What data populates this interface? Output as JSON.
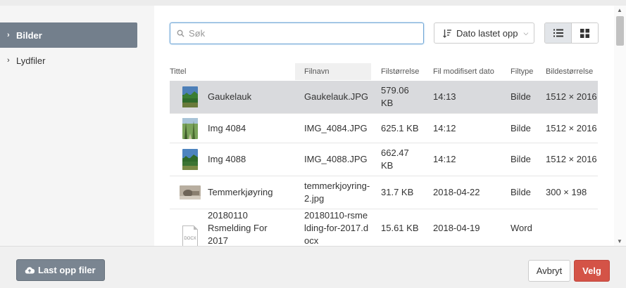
{
  "sidebar": {
    "items": [
      {
        "label": "Bilder",
        "active": true
      },
      {
        "label": "Lydfiler",
        "active": false
      }
    ]
  },
  "search": {
    "placeholder": "Søk",
    "value": ""
  },
  "sort": {
    "label": "Dato lastet opp",
    "icon": "sort-icon"
  },
  "view": {
    "list_icon": "list-view-icon",
    "grid_icon": "grid-view-icon",
    "active": "list"
  },
  "table": {
    "columns": [
      "Tittel",
      "Filnavn",
      "Filstørrelse",
      "Fil modifisert dato",
      "Filtype",
      "Bildestørrelse"
    ],
    "sorted_column": "Filnavn",
    "rows": [
      {
        "title": "Gaukelauk",
        "filename": "Gaukelauk.JPG",
        "size": "579.06 KB",
        "modified": "14:13",
        "type": "Bilde",
        "dimensions": "1512 × 2016",
        "thumb": "landscape-photo-thumb",
        "selected": true
      },
      {
        "title": "Img 4084",
        "filename": "IMG_4084.JPG",
        "size": "625.1 KB",
        "modified": "14:12",
        "type": "Bilde",
        "dimensions": "1512 × 2016",
        "thumb": "forest-photo-thumb",
        "selected": false
      },
      {
        "title": "Img 4088",
        "filename": "IMG_4088.JPG",
        "size": "662.47 KB",
        "modified": "14:12",
        "type": "Bilde",
        "dimensions": "1512 × 2016",
        "thumb": "landscape-photo-thumb",
        "selected": false
      },
      {
        "title": "Temmerkjøyring",
        "filename": "temmerkjoyring-2.jpg",
        "size": "31.7 KB",
        "modified": "2018-04-22",
        "type": "Bilde",
        "dimensions": "300 × 198",
        "thumb": "sepia-photo-thumb",
        "selected": false
      },
      {
        "title": "20180110 Rsmelding For 2017",
        "filename": "20180110-rsmelding-for-2017.docx",
        "size": "15.61 KB",
        "modified": "2018-04-19",
        "type": "Word",
        "dimensions": "",
        "thumb": "docx-file-icon",
        "thumb_label": "DOCX",
        "selected": false
      }
    ]
  },
  "footer": {
    "upload_label": "Last opp filer",
    "upload_icon": "cloud-upload-icon",
    "cancel_label": "Avbryt",
    "ok_label": "Velg"
  },
  "colors": {
    "active_nav": "#737f8c",
    "primary_button": "#d45347",
    "selected_row": "#d9dadd"
  }
}
